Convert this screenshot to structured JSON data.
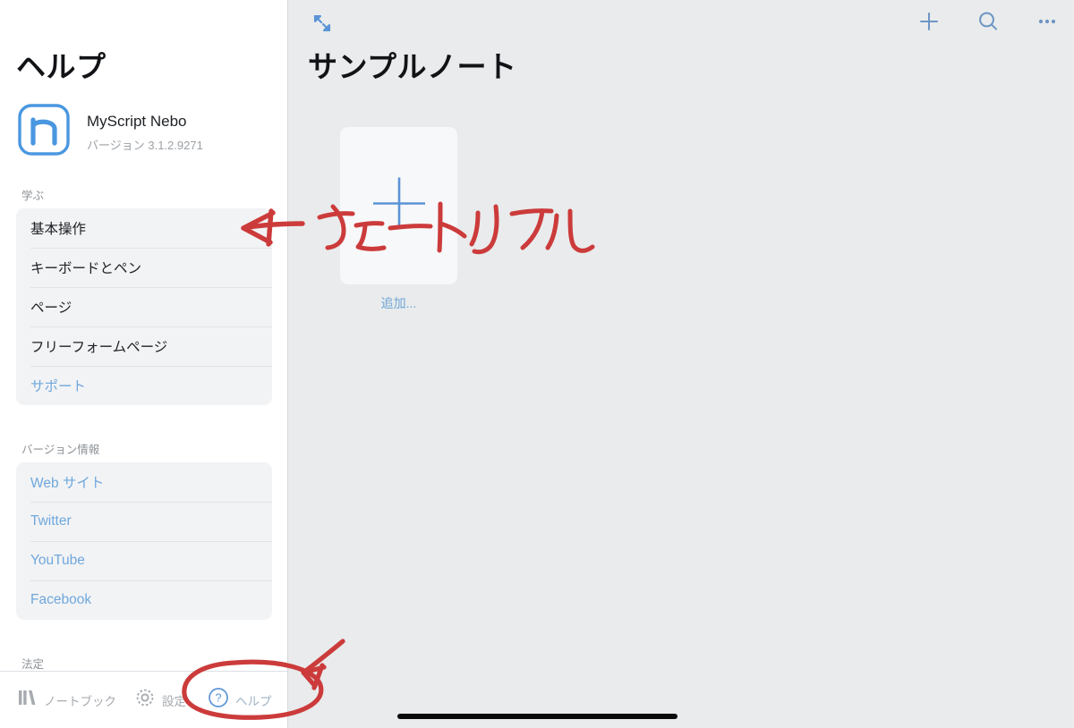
{
  "sidebar": {
    "title": "ヘルプ",
    "app": {
      "icon": "nebo-app-icon",
      "name": "MyScript Nebo",
      "version": "バージョン 3.1.2.9271"
    },
    "sections": [
      {
        "header": "学ぶ",
        "items": [
          {
            "label": "基本操作",
            "style": "normal"
          },
          {
            "label": "キーボードとペン",
            "style": "normal"
          },
          {
            "label": "ページ",
            "style": "normal"
          },
          {
            "label": "フリーフォームページ",
            "style": "normal"
          },
          {
            "label": "サポート",
            "style": "link"
          }
        ]
      },
      {
        "header": "バージョン情報",
        "items": [
          {
            "label": "Web サイト",
            "style": "link"
          },
          {
            "label": "Twitter",
            "style": "link"
          },
          {
            "label": "YouTube",
            "style": "link"
          },
          {
            "label": "Facebook",
            "style": "link"
          }
        ]
      },
      {
        "header": "法定",
        "items": []
      }
    ]
  },
  "toolbar": {
    "items": [
      {
        "icon": "books-icon",
        "label": "ノートブック",
        "active": false
      },
      {
        "icon": "gear-icon",
        "label": "設定",
        "active": false
      },
      {
        "icon": "question-circle-icon",
        "label": "ヘルプ",
        "active": true
      }
    ]
  },
  "main": {
    "expand_icon": "expand-collapse-icon",
    "actions": [
      {
        "icon": "plus-icon",
        "name": "add"
      },
      {
        "icon": "search-icon",
        "name": "search"
      },
      {
        "icon": "ellipsis-icon",
        "name": "more"
      }
    ],
    "note_title": "サンプルノート",
    "add_card": {
      "icon": "plus-icon",
      "label": "追加..."
    }
  },
  "annotations": {
    "handwriting_text": "← チュートリアル",
    "circle_target": "ヘルプ",
    "ink_color": "#cc3b3b"
  },
  "colors": {
    "accent_blue": "#6fa8dc",
    "icon_blue": "#5b94d6",
    "sidebar_bg": "#ffffff",
    "main_bg": "#e9ebec",
    "list_bg": "#f2f3f5",
    "text_primary": "#1d2024",
    "text_muted": "#8d9297",
    "ink_red": "#cc3b3b"
  }
}
